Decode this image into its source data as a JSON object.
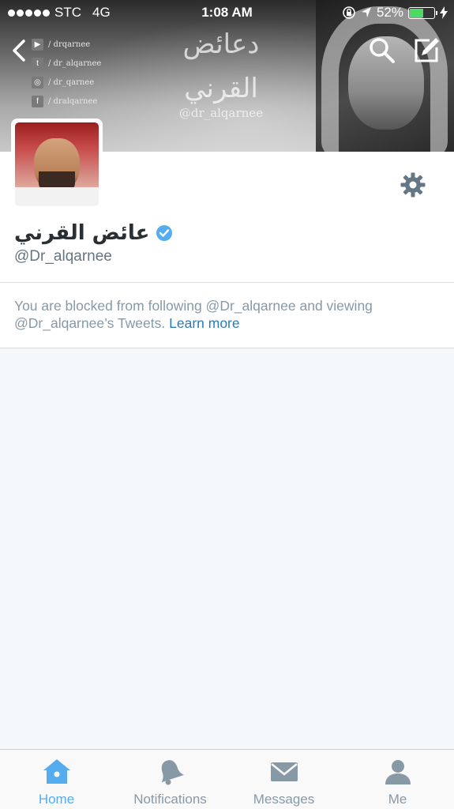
{
  "status_bar": {
    "carrier": "STC",
    "network": "4G",
    "time": "1:08 AM",
    "battery": "52%"
  },
  "header": {
    "banner_title": "دعائض القرني",
    "banner_handle": "@dr_alqarnee",
    "social": [
      {
        "icon": "youtube-icon",
        "glyph": "▶",
        "text": "/ drqarnee"
      },
      {
        "icon": "twitter-icon",
        "glyph": "t",
        "text": "/ dr_alqarnee"
      },
      {
        "icon": "instagram-icon",
        "glyph": "◎",
        "text": "/ dr_qarnee"
      },
      {
        "icon": "facebook-icon",
        "glyph": "f",
        "text": "/ dralqarnee"
      }
    ]
  },
  "profile": {
    "name": "عائض القرني",
    "handle": "@Dr_alqarnee",
    "verified": true
  },
  "notice": {
    "text": "You are blocked from following @Dr_alqarnee and viewing @Dr_alqarnee’s Tweets.",
    "link": "Learn more"
  },
  "tabs": [
    {
      "label": "Home",
      "icon": "home-icon",
      "active": true
    },
    {
      "label": "Notifications",
      "icon": "bell-icon",
      "active": false
    },
    {
      "label": "Messages",
      "icon": "envelope-icon",
      "active": false
    },
    {
      "label": "Me",
      "icon": "person-icon",
      "active": false
    }
  ],
  "colors": {
    "accent": "#55acee",
    "inactive": "#8899a6",
    "link": "#2b7bb9",
    "background": "#f5f8fa"
  }
}
